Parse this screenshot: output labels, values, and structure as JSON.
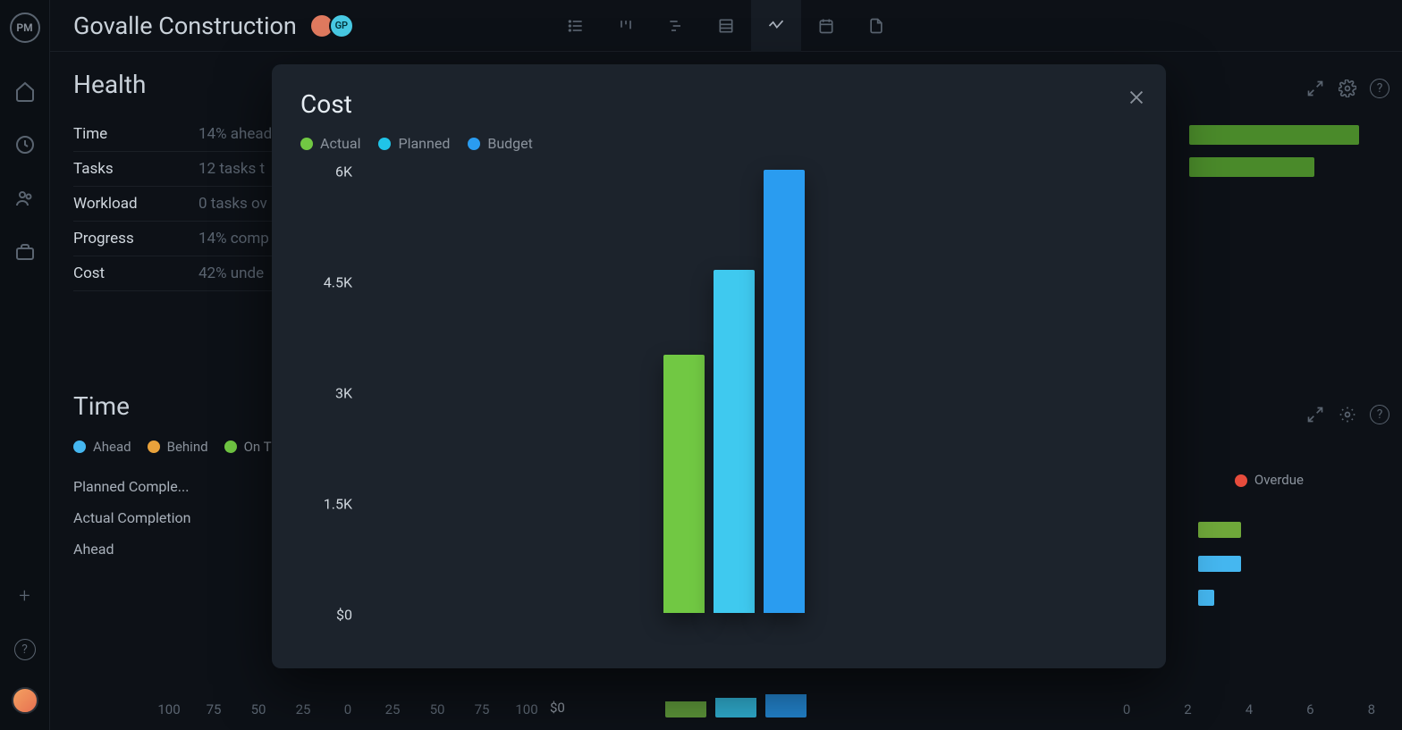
{
  "project_title": "Govalle Construction",
  "avatar2_initials": "GP",
  "logo_text": "PM",
  "health": {
    "title": "Health",
    "rows": [
      {
        "label": "Time",
        "value": "14% ahead"
      },
      {
        "label": "Tasks",
        "value": "12 tasks t"
      },
      {
        "label": "Workload",
        "value": "0 tasks ov"
      },
      {
        "label": "Progress",
        "value": "14% comp"
      },
      {
        "label": "Cost",
        "value": "42% unde"
      }
    ]
  },
  "time": {
    "title": "Time",
    "legend": [
      "Ahead",
      "Behind",
      "On T"
    ],
    "rows": [
      "Planned Comple...",
      "Actual Completion",
      "Ahead"
    ],
    "axis": [
      "100",
      "75",
      "50",
      "25",
      "0",
      "25",
      "50",
      "75",
      "100"
    ]
  },
  "right_overdue_label": "Overdue",
  "right_axis": [
    "0",
    "2",
    "4",
    "6",
    "8"
  ],
  "peek_y_label": "$0",
  "modal": {
    "title": "Cost",
    "legend": [
      {
        "label": "Actual",
        "color": "#71c843"
      },
      {
        "label": "Planned",
        "color": "#20c4e8"
      },
      {
        "label": "Budget",
        "color": "#2a9cf0"
      }
    ]
  },
  "chart_data": {
    "type": "bar",
    "title": "Cost",
    "xlabel": "",
    "ylabel": "",
    "ylim": [
      0,
      6000
    ],
    "y_ticks": [
      "6K",
      "4.5K",
      "3K",
      "1.5K",
      "$0"
    ],
    "categories": [
      ""
    ],
    "series": [
      {
        "name": "Actual",
        "color": "#71c843",
        "values": [
          3500
        ]
      },
      {
        "name": "Planned",
        "color": "#3fc9ef",
        "values": [
          4650
        ]
      },
      {
        "name": "Budget",
        "color": "#2a9cf0",
        "values": [
          6000
        ]
      }
    ]
  }
}
